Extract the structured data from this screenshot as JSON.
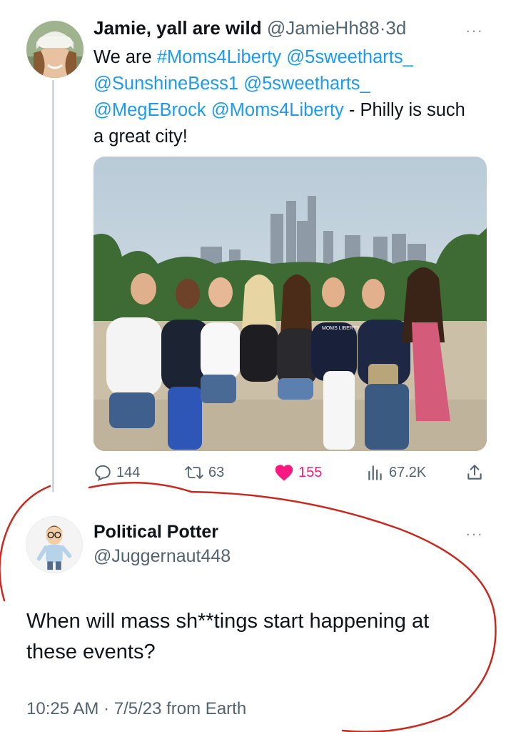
{
  "tweet": {
    "author_name": "Jamie, yall are wild",
    "author_handle": "@JamieHh88",
    "separator": "·",
    "age": "3d",
    "more": "···",
    "text_parts": {
      "t1": "We are ",
      "l1": "#Moms4Liberty",
      "t2": " ",
      "l2": "@5sweetharts_",
      "t3": " ",
      "l3": "@SunshineBess1",
      "t4": " ",
      "l4": "@5sweetharts_",
      "t5": " ",
      "l5": "@MegEBrock",
      "t6": " ",
      "l6": "@Moms4Liberty",
      "t7": "  - Philly is such a great city!"
    },
    "photo_shirt_text": "MOMS\nLIBERTY",
    "metrics": {
      "replies": "144",
      "retweets": "63",
      "likes": "155",
      "views": "67.2K"
    }
  },
  "reply": {
    "author_name": "Political Potter",
    "author_handle": "@Juggernaut448",
    "more": "···",
    "text": "When will mass sh**tings start happening at these events?",
    "timestamp": "10:25 AM",
    "separator": " · ",
    "date": "7/5/23",
    "source": " from Earth"
  },
  "colors": {
    "link": "#1d9bf0",
    "like": "#f91880",
    "annotation": "#c9281f"
  },
  "icons": [
    "reply-icon",
    "retweet-icon",
    "heart-icon",
    "views-icon",
    "share-icon",
    "more-icon"
  ]
}
